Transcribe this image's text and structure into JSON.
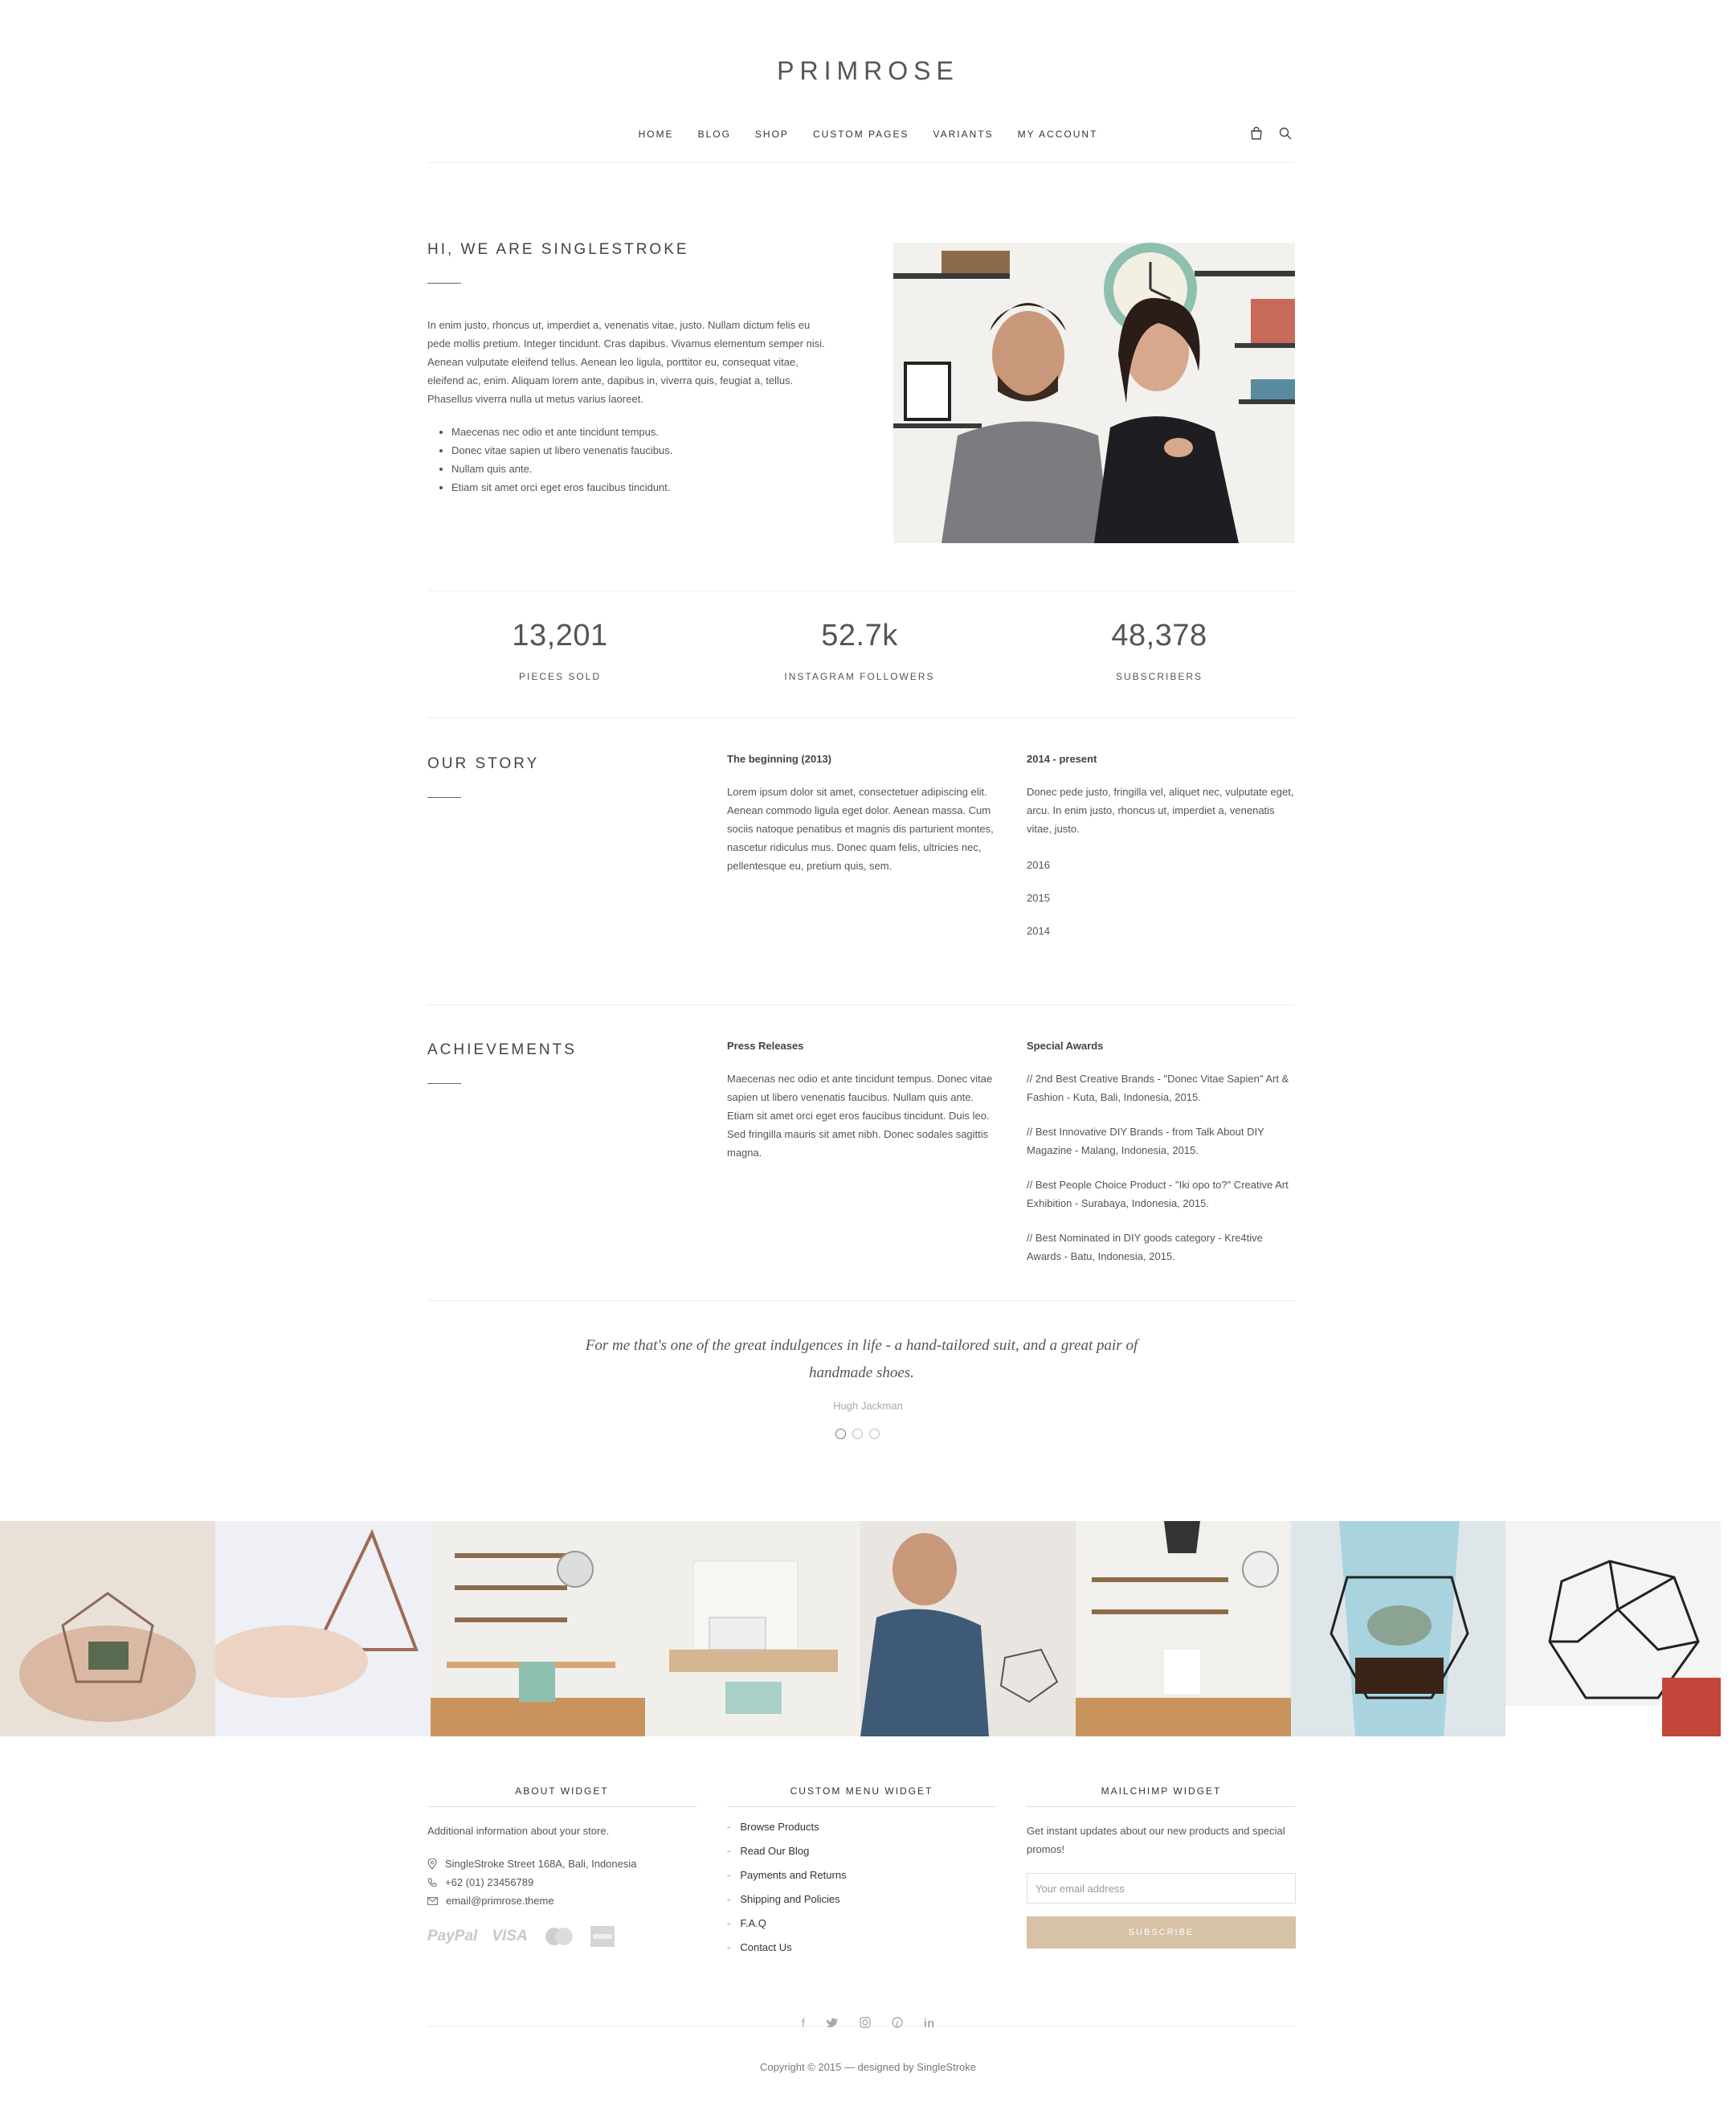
{
  "brand": {
    "logo": "PRIMROSE"
  },
  "nav": {
    "items": [
      "HOME",
      "BLOG",
      "SHOP",
      "CUSTOM PAGES",
      "VARIANTS",
      "MY ACCOUNT"
    ]
  },
  "intro": {
    "title": "HI, WE ARE SINGLESTROKE",
    "body": "In enim justo, rhoncus ut, imperdiet a, venenatis vitae, justo. Nullam dictum felis eu pede mollis pretium. Integer tincidunt. Cras dapibus. Vivamus elementum semper nisi. Aenean vulputate eleifend tellus. Aenean leo ligula, porttitor eu, consequat vitae, eleifend ac, enim. Aliquam lorem ante, dapibus in, viverra quis, feugiat a, tellus. Phasellus viverra nulla ut metus varius laoreet.",
    "bullets": [
      "Maecenas nec odio et ante tincidunt tempus.",
      "Donec vitae sapien ut libero venenatis faucibus.",
      "Nullam quis ante.",
      "Etiam sit amet orci eget eros faucibus tincidunt."
    ]
  },
  "stats": [
    {
      "number": "13,201",
      "label": "PIECES SOLD"
    },
    {
      "number": "52.7k",
      "label": "INSTAGRAM FOLLOWERS"
    },
    {
      "number": "48,378",
      "label": "SUBSCRIBERS"
    }
  ],
  "story": {
    "title": "OUR STORY",
    "col1_title": "The beginning (2013)",
    "col1_body": "Lorem ipsum dolor sit amet, consectetuer adipiscing elit. Aenean commodo ligula eget dolor. Aenean massa. Cum sociis natoque penatibus et magnis dis parturient montes, nascetur ridiculus mus. Donec quam felis, ultricies nec, pellentesque eu, pretium quis, sem.",
    "col2_title": "2014 - present",
    "col2_body": "Donec pede justo, fringilla vel, aliquet nec, vulputate eget, arcu. In enim justo, rhoncus ut, imperdiet a, venenatis vitae, justo.",
    "years": [
      "2016",
      "2015",
      "2014"
    ]
  },
  "achievements": {
    "title": "ACHIEVEMENTS",
    "col1_title": "Press Releases",
    "col1_body": "Maecenas nec odio et ante tincidunt tempus. Donec vitae sapien ut libero venenatis faucibus. Nullam quis ante. Etiam sit amet orci eget eros faucibus tincidunt. Duis leo. Sed fringilla mauris sit amet nibh. Donec sodales sagittis magna.",
    "col2_title": "Special Awards",
    "awards": [
      "// 2nd Best Creative Brands - \"Donec Vitae Sapien\" Art & Fashion - Kuta, Bali, Indonesia, 2015.",
      "// Best Innovative DIY Brands - from Talk About DIY Magazine - Malang, Indonesia, 2015.",
      "// Best People Choice Product - \"Iki opo to?\" Creative Art Exhibition - Surabaya, Indonesia, 2015.",
      "// Best Nominated in DIY goods category - Kre4tive Awards - Batu, Indonesia, 2015."
    ]
  },
  "testimonial": {
    "quote": "For me that's one of the great indulgences in life - a hand-tailored suit, and a great pair of handmade shoes.",
    "author": "Hugh Jackman",
    "active_slide": 1,
    "slides": 3
  },
  "footer": {
    "about": {
      "title": "ABOUT WIDGET",
      "text": "Additional information about your store.",
      "address": "SingleStroke Street 168A, Bali, Indonesia",
      "phone": "+62 (01) 23456789",
      "email": "email@primrose.theme",
      "payments": [
        "PayPal",
        "VISA",
        "MasterCard",
        "American Express"
      ]
    },
    "menu": {
      "title": "CUSTOM MENU WIDGET",
      "items": [
        "Browse Products",
        "Read Our Blog",
        "Payments and Returns",
        "Shipping and Policies",
        "F.A.Q",
        "Contact Us"
      ]
    },
    "mailchimp": {
      "title": "MAILCHIMP WIDGET",
      "text": "Get instant updates about our new products and special promos!",
      "placeholder": "Your email address",
      "button": "SUBSCRIBE"
    },
    "social": [
      "facebook-icon",
      "twitter-icon",
      "instagram-icon",
      "pinterest-icon",
      "linkedin-icon"
    ],
    "copyright": "Copyright © 2015 — designed by SingleStroke"
  },
  "colors": {
    "accent": "#d7c2a7",
    "text": "#555555",
    "divider": "#eeeeee"
  }
}
